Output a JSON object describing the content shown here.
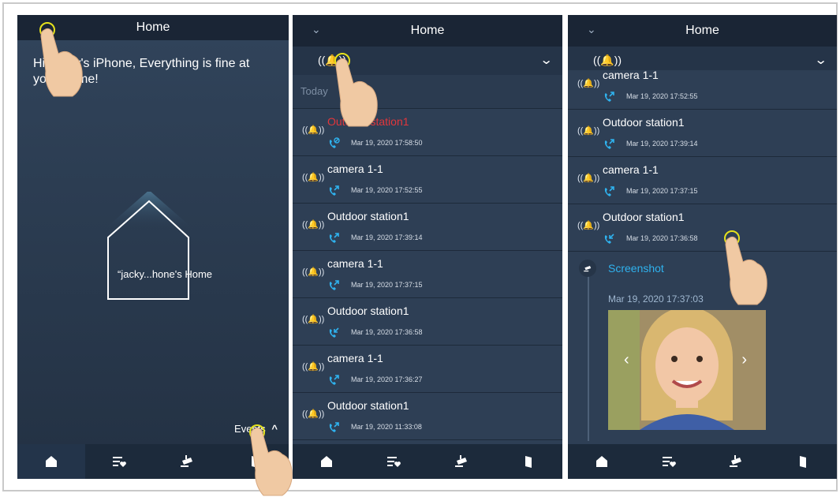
{
  "colors": {
    "accent": "#2fb2ee",
    "missed": "#e2363b",
    "bg": "#2e3f55",
    "header": "#1a2535"
  },
  "screen1": {
    "title": "Home",
    "welcome": "Hi, jacky's iPhone, Everything is fine at your Home!",
    "house_label": "“jacky...hone's Home",
    "events_label": "Events"
  },
  "screen2": {
    "title": "Home",
    "today": "Today",
    "rows": [
      {
        "name": "Outdoor station1",
        "time": "Mar 19, 2020 17:58:50",
        "status": "missed"
      },
      {
        "name": "camera 1-1",
        "time": "Mar 19, 2020 17:52:55",
        "status": "outgoing"
      },
      {
        "name": "Outdoor station1",
        "time": "Mar 19, 2020 17:39:14",
        "status": "outgoing"
      },
      {
        "name": "camera 1-1",
        "time": "Mar 19, 2020 17:37:15",
        "status": "outgoing"
      },
      {
        "name": "Outdoor station1",
        "time": "Mar 19, 2020 17:36:58",
        "status": "incoming"
      },
      {
        "name": "camera 1-1",
        "time": "Mar 19, 2020 17:36:27",
        "status": "outgoing"
      },
      {
        "name": "Outdoor station1",
        "time": "Mar 19, 2020 11:33:08",
        "status": "outgoing"
      }
    ]
  },
  "screen3": {
    "title": "Home",
    "rows": [
      {
        "name": "camera 1-1",
        "time": "Mar 19, 2020 17:52:55",
        "status": "outgoing"
      },
      {
        "name": "Outdoor station1",
        "time": "Mar 19, 2020 17:39:14",
        "status": "outgoing"
      },
      {
        "name": "camera 1-1",
        "time": "Mar 19, 2020 17:37:15",
        "status": "outgoing"
      },
      {
        "name": "Outdoor station1",
        "time": "Mar 19, 2020 17:36:58",
        "status": "incoming"
      }
    ],
    "screenshot_label": "Screenshot",
    "screenshot_time": "Mar 19, 2020 17:37:03"
  },
  "tabs": [
    {
      "name": "home-tab",
      "icon": "home-icon"
    },
    {
      "name": "scenes-tab",
      "icon": "list-heart-icon"
    },
    {
      "name": "camera-tab",
      "icon": "camera-icon"
    },
    {
      "name": "door-tab",
      "icon": "door-icon"
    }
  ],
  "bell_glyph": "((🔔))",
  "chevron_down": "⌄",
  "chevron_up": "^",
  "prev_arrow": "‹",
  "next_arrow": "›"
}
